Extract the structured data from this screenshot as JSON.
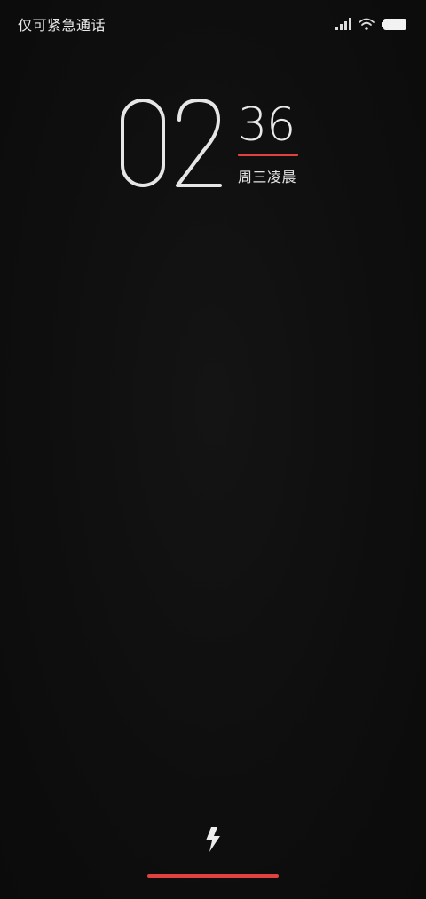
{
  "status_bar": {
    "carrier_text": "仅可紧急通话",
    "icons": [
      "signal-icon",
      "wifi-icon",
      "battery-icon"
    ]
  },
  "clock": {
    "hours": "02",
    "minutes": "36",
    "date_label": "周三凌晨"
  },
  "charging": {
    "icon": "lightning-icon",
    "progress": 1.0
  },
  "colors": {
    "background": "#0e0e0e",
    "accent": "#e0433d",
    "text": "#e6e6e6"
  }
}
